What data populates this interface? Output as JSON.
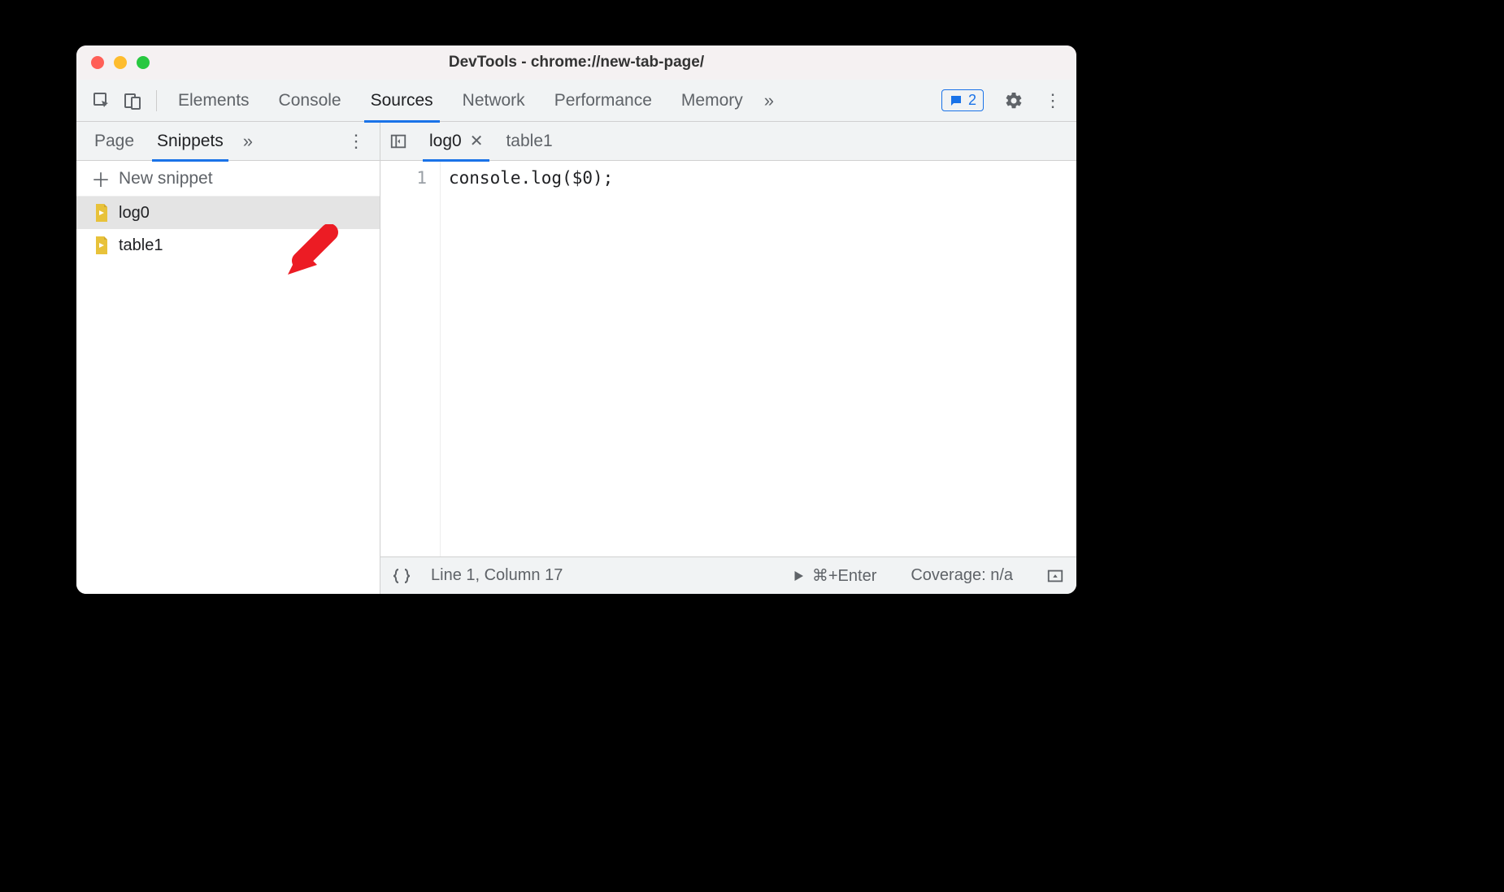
{
  "window": {
    "title": "DevTools - chrome://new-tab-page/"
  },
  "mainTabs": {
    "items": [
      "Elements",
      "Console",
      "Sources",
      "Network",
      "Performance",
      "Memory"
    ],
    "activeIndex": 2,
    "messagesBadge": "2"
  },
  "leftPanel": {
    "subTabs": {
      "items": [
        "Page",
        "Snippets"
      ],
      "activeIndex": 1
    },
    "newSnippetLabel": "New snippet",
    "snippets": [
      {
        "name": "log0",
        "selected": true
      },
      {
        "name": "table1",
        "selected": false
      }
    ]
  },
  "editor": {
    "openTabs": [
      {
        "name": "log0",
        "active": true,
        "closeVisible": true
      },
      {
        "name": "table1",
        "active": false,
        "closeVisible": false
      }
    ],
    "lines": [
      {
        "num": "1",
        "text": "console.log($0);"
      }
    ]
  },
  "status": {
    "cursor": "Line 1, Column 17",
    "runHint": "⌘+Enter",
    "coverage": "Coverage: n/a"
  }
}
